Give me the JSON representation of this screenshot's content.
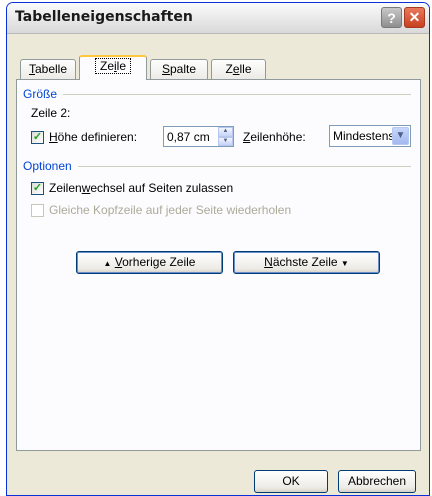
{
  "window": {
    "title": "Tabelleneigenschaften"
  },
  "title_buttons": {
    "help": "?",
    "close": "✕"
  },
  "tabs": [
    {
      "label": "Tabelle",
      "mnemonic": "T",
      "rest": "abelle",
      "active": false
    },
    {
      "label": "Zeile",
      "pre": "Ze",
      "mnemonic": "i",
      "rest": "le",
      "active": true
    },
    {
      "label": "Spalte",
      "mnemonic": "S",
      "rest": "palte",
      "active": false
    },
    {
      "label": "Zelle",
      "pre": "Z",
      "mnemonic": "e",
      "rest": "lle",
      "active": false
    }
  ],
  "size_group": {
    "header": "Größe",
    "row_label": "Zeile 2:",
    "define_height": {
      "mnemonic": "H",
      "rest": "öhe definieren:",
      "checked": true
    },
    "height_value": "0,87 cm",
    "row_height_label": {
      "mnemonic": "Z",
      "rest": "eilenhöhe:"
    },
    "row_height_select": "Mindestens"
  },
  "options_group": {
    "header": "Optionen",
    "allow_break": {
      "pre": "Zeilen",
      "mnemonic": "w",
      "rest": "echsel auf Seiten zulassen",
      "checked": true
    },
    "repeat_header": {
      "label": "Gleiche Kopfzeile auf jeder Seite wiederholen",
      "checked": false,
      "disabled": true
    }
  },
  "nav_buttons": {
    "previous": {
      "arrow": "▲",
      "mnemonic": "V",
      "rest": "orherige Zeile"
    },
    "next": {
      "mnemonic": "N",
      "rest": "ächste Zeile",
      "arrow": "▼"
    }
  },
  "footer": {
    "ok": "OK",
    "cancel": "Abbrechen"
  }
}
